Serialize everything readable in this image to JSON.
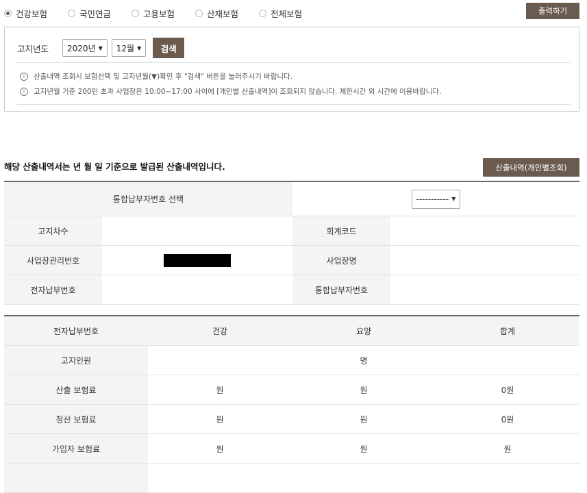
{
  "radios": [
    {
      "label": "건강보험",
      "selected": true
    },
    {
      "label": "국민연금",
      "selected": false
    },
    {
      "label": "고용보험",
      "selected": false
    },
    {
      "label": "산재보험",
      "selected": false
    },
    {
      "label": "전체보험",
      "selected": false
    }
  ],
  "print_label": "출력하기",
  "search": {
    "label": "고지년도",
    "year": "2020년",
    "month": "12월",
    "button": "검색"
  },
  "notices": [
    "산출내역 조회시 보험선택 및 고지년월(▼)확인 후 \"검색\" 버튼을 눌러주시기 바랍니다.",
    "고지년월 기준 200인 초과 사업장은 10:00~17:00 사이에 [개인별 산출내역]이 조회되지 않습니다. 제한시간 외 시간에 이용바랍니다."
  ],
  "section_title": "해당 산출내역서는 년 월 일 기준으로 발급된 산출내역입니다.",
  "detail_button": "산출내역(개인별조회)",
  "info_table": {
    "select_label": "통합납부자번호 선택",
    "select_value": "-----------",
    "notice_round": "고지차수",
    "account_code": "회계코드",
    "biz_mgmt_no": "사업장관리번호",
    "biz_name": "사업장명",
    "e_payment_no": "전자납부번호",
    "integrated_payer_no": "통합납부자번호"
  },
  "fee_table": {
    "headers": [
      "전자납부번호",
      "건강",
      "요양",
      "합계"
    ],
    "rows": [
      {
        "label": "고지인원",
        "merged": "명"
      },
      {
        "label": "산출 보험료",
        "cells": [
          "원",
          "원",
          "0원"
        ]
      },
      {
        "label": "정산 보험료",
        "cells": [
          "원",
          "원",
          "0원"
        ]
      },
      {
        "label": "가입자 보험료",
        "cells": [
          "원",
          "원",
          "원"
        ]
      }
    ]
  }
}
